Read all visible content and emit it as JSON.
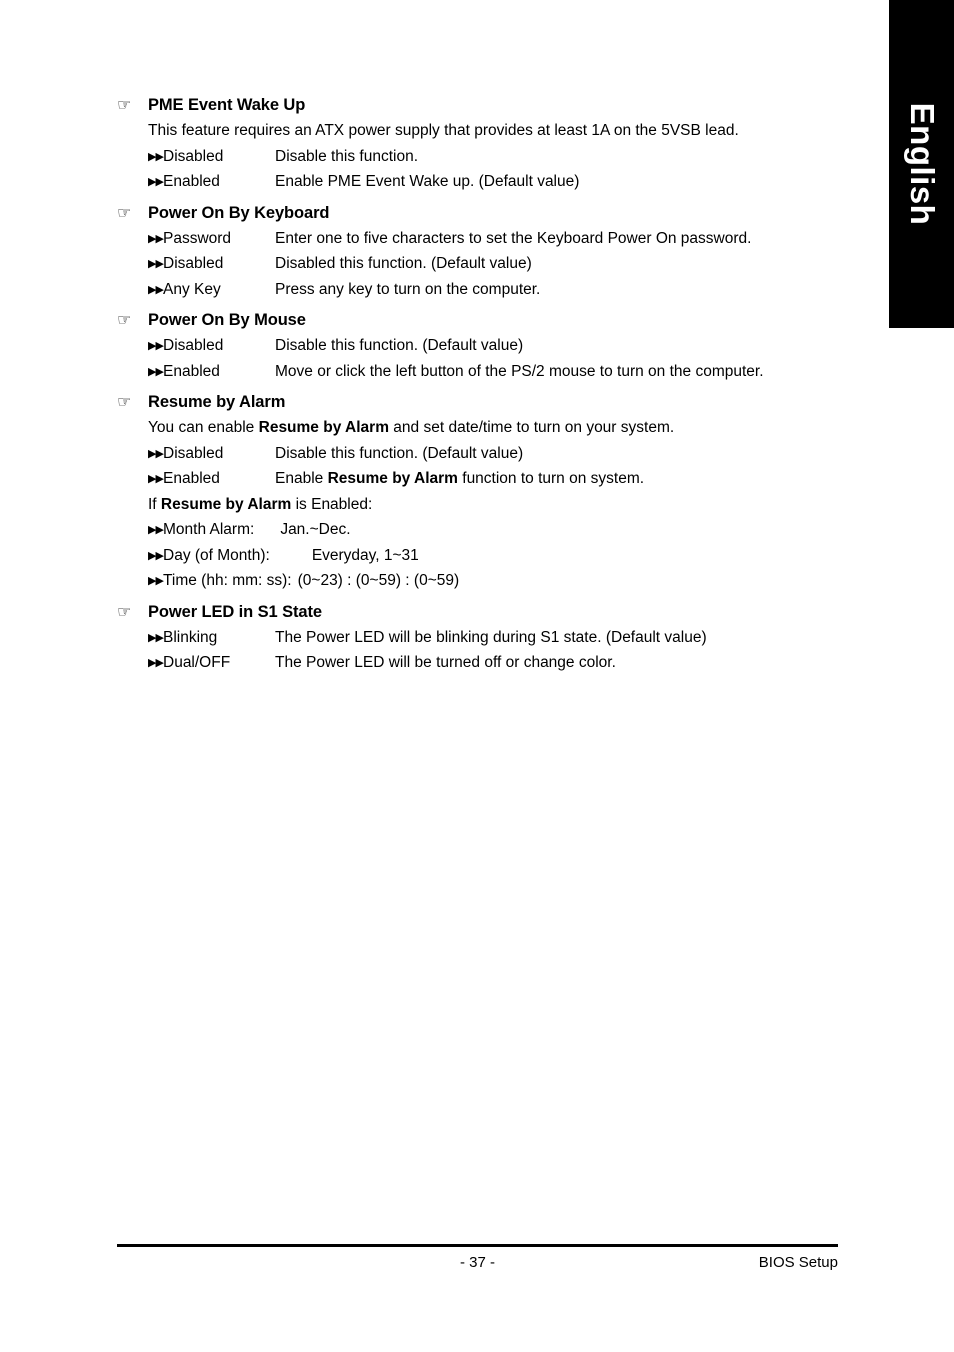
{
  "sidebar_tab": {
    "label": "English",
    "background": "#000000",
    "text_color": "#ffffff"
  },
  "icons": {
    "hand": "☞",
    "bullet": "▶▶"
  },
  "sections": [
    {
      "title": "PME Event Wake Up",
      "paragraph": "This feature requires an ATX power supply that provides at least 1A on the 5VSB lead.",
      "options": [
        {
          "label": "Disabled",
          "desc": "Disable this function."
        },
        {
          "label": "Enabled",
          "desc": "Enable PME Event Wake up. (Default value)"
        }
      ]
    },
    {
      "title": "Power On By Keyboard",
      "options": [
        {
          "label": "Password",
          "desc": "Enter one to five characters to set the Keyboard Power On password."
        },
        {
          "label": "Disabled",
          "desc": "Disabled this function. (Default value)"
        },
        {
          "label": "Any Key",
          "desc": "Press any key to turn on the computer."
        }
      ]
    },
    {
      "title": "Power On By Mouse",
      "options": [
        {
          "label": "Disabled",
          "desc": "Disable this function. (Default value)"
        },
        {
          "label": "Enabled",
          "desc": "Move or click the left button of the PS/2 mouse to turn on the computer."
        }
      ]
    },
    {
      "title": "Resume by Alarm",
      "paragraph_parts": {
        "pre": "You can enable ",
        "bold": "Resume by Alarm",
        "post": " and set date/time to turn on your system."
      },
      "options": [
        {
          "label": "Disabled",
          "desc": "Disable this function. (Default value)"
        },
        {
          "label": "Enabled",
          "desc_parts": {
            "pre": "Enable ",
            "bold": "Resume by Alarm",
            "post": " function to turn on system."
          }
        }
      ],
      "condition_line": {
        "pre": "If ",
        "bold": "Resume by Alarm",
        "post": " is Enabled:"
      },
      "alarm_fields": [
        {
          "label": "Month Alarm:",
          "value": "Jan.~Dec."
        },
        {
          "label": "Day (of Month):",
          "value": "Everyday, 1~31"
        },
        {
          "label": "Time (hh: mm: ss):",
          "value": "(0~23) : (0~59) : (0~59)"
        }
      ]
    },
    {
      "title": "Power LED in S1 State",
      "options": [
        {
          "label": "Blinking",
          "desc": "The Power LED will be blinking during S1 state. (Default value)"
        },
        {
          "label": "Dual/OFF",
          "desc": "The Power LED will be turned off or change color."
        }
      ]
    }
  ],
  "footer": {
    "page_number": "- 37 -",
    "document_label": "BIOS Setup"
  }
}
